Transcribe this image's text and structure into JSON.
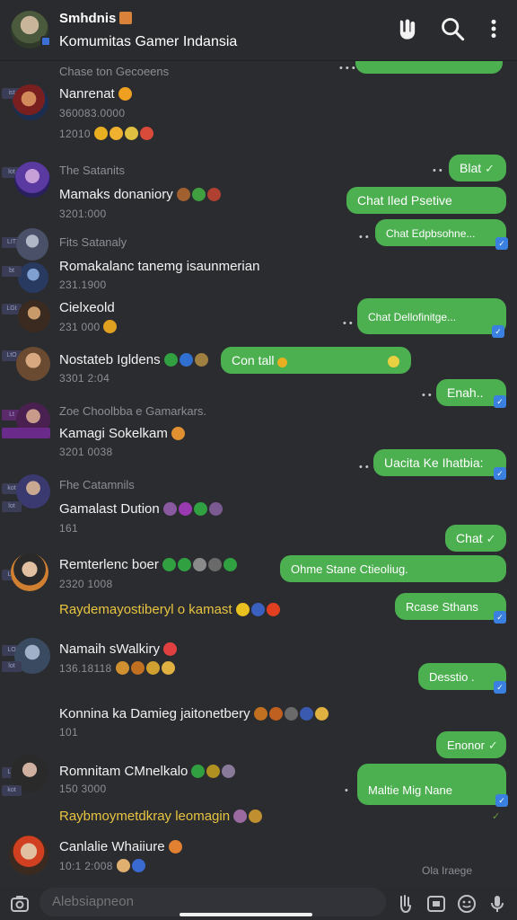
{
  "header": {
    "title": "Smhdnis",
    "subtitle": "Komumitas Gamer Indansia",
    "icons": [
      "mute-icon",
      "search-icon",
      "more-vert-icon"
    ]
  },
  "colors": {
    "bubble": "#4caf50",
    "bg": "#2b2c30",
    "accent_yellow": "#e8c440",
    "tick_blue": "#3a80e0"
  },
  "messages": [
    {
      "group": "Chase ton Gecoeens",
      "name": "Nanrenat",
      "meta": "360083.0000",
      "meta2": "12010"
    },
    {
      "group": "The Satanits",
      "name": "Mamaks donaniory",
      "meta": "3201:000"
    },
    {
      "group": "Fits Satanaly",
      "name": "Romakalanc tanemg isaunmerian",
      "meta": "231.1900"
    },
    {
      "name": "Cielxeold",
      "meta": "231 000"
    },
    {
      "name": "Nostateb Igldens",
      "meta": "3301 2:04"
    },
    {
      "group": "Zoe Choolbba e Gamarkars.",
      "name": "Kamagi Sokelkam",
      "meta": "3201 0038"
    },
    {
      "group": "Fhe Catamnils",
      "name": "Gamalast Dution",
      "meta": "161"
    },
    {
      "name": "Remterlenc boer",
      "meta": "2320 1008"
    },
    {
      "name": "Raydemayostiberyl o kamast"
    },
    {
      "name": "Namaih sWalkiry",
      "meta": "136.18118"
    },
    {
      "name": "Konnina ka Damieg jaitonetbery",
      "meta": "101"
    },
    {
      "name": "Romnitam CMnelkalo",
      "meta": "150 3000"
    },
    {
      "name": "Raybmoymetdkray leomagin"
    },
    {
      "name": "Canlalie Whaiiure",
      "meta": "10:1 2:008"
    }
  ],
  "bubbles": [
    {
      "text": ""
    },
    {
      "text": "Blat"
    },
    {
      "text": "Chat Iled Psetive"
    },
    {
      "text": "Chat Edpbsohne..."
    },
    {
      "text": "Chat Dellofinitge..."
    },
    {
      "text": "Con tall"
    },
    {
      "text": "Enah.."
    },
    {
      "text": "Uacita Ke Ihatbia:"
    },
    {
      "text": "Chat"
    },
    {
      "text": "Ohme Stane Ctieoliug."
    },
    {
      "text": "Rcase Sthans"
    },
    {
      "text": "Desstio ."
    },
    {
      "text": "Enonor"
    },
    {
      "text": "Maltie Mig Nane"
    }
  ],
  "footer_status": "Ola Iraege",
  "composer": {
    "placeholder": "Alebsiapneon",
    "icons": [
      "camera-icon",
      "sticker-icon",
      "gif-icon",
      "emoji-icon",
      "mic-icon"
    ]
  }
}
